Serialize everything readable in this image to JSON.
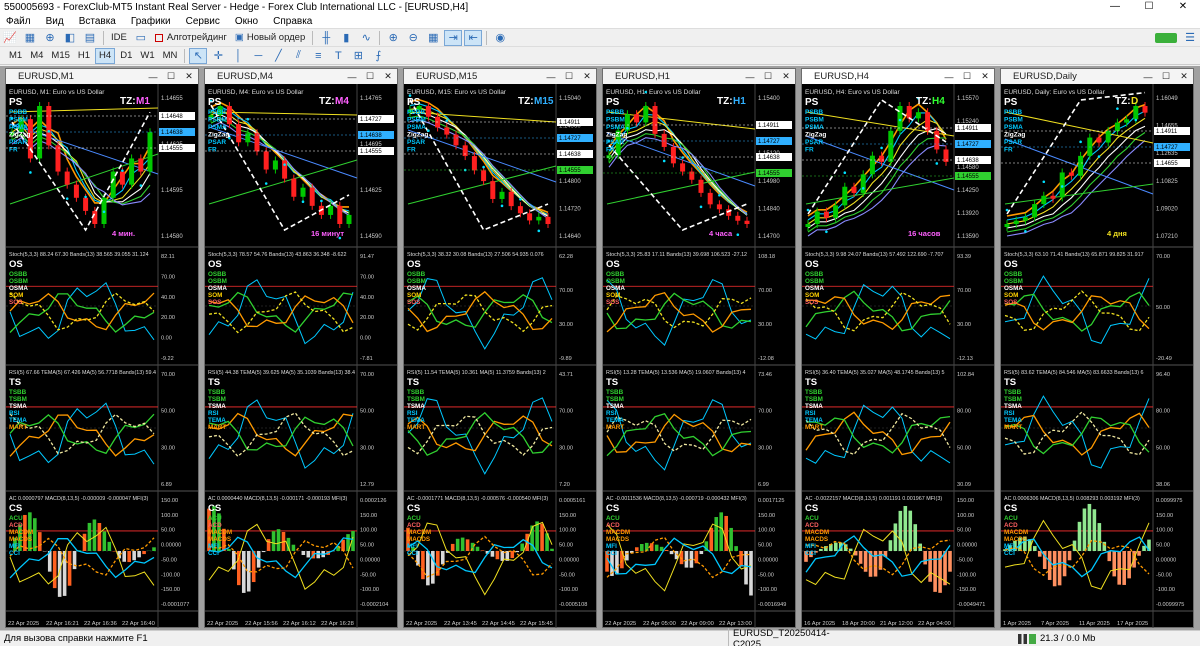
{
  "window": {
    "title": "550005693 - ForexClub-MT5 Instant Real Server - Hedge - Forex Club International LLC - [EURUSD,H4]",
    "minimize": "—",
    "maximize": "☐",
    "close": "✕"
  },
  "menu": [
    "Файл",
    "Вид",
    "Вставка",
    "Графики",
    "Сервис",
    "Окно",
    "Справка"
  ],
  "toolbar": {
    "ide": "IDE",
    "algo": "Алготрейдинг",
    "new_order": "Новый ордер",
    "timeframes": [
      "M1",
      "M4",
      "M15",
      "H1",
      "H4",
      "D1",
      "W1",
      "MN"
    ],
    "active_timeframe": "H4"
  },
  "status": {
    "help": "Для вызова справки нажмите F1",
    "profile": "EURUSD_T20250414-C2025",
    "traffic": "21.3 / 0.0 Mb"
  },
  "colors": {
    "chart_bg": "#000000",
    "bull": "#00c800",
    "bear": "#ff2020",
    "line_orange": "#ff9a00",
    "line_cyan": "#00c8ff",
    "line_yellow": "#f0e020",
    "line_green": "#30d030",
    "line_white": "#ffffff",
    "level_red": "#ff3030"
  },
  "charts": [
    {
      "tab": "EURUSD,M1",
      "pair_caption": "EURUSD, M1:  Euro vs US Dollar",
      "tz": "TZ:",
      "tz_tf": "M1",
      "tz_color": "#ff60ff",
      "timer": "4 мин.",
      "prices": [
        "1.14655",
        "1.14625",
        "1.14595",
        "1.14580"
      ],
      "price_tags": [
        "1.14648",
        "1.14638",
        "1.14555"
      ],
      "osc1_values": "Stoch(5,3,3) 88.24  67.30  Bands(13) 38.565  39.055  31.124",
      "osc1_levels": [
        "82.11",
        "70.00",
        "40.00",
        "20.00",
        "0.00",
        "-9.22"
      ],
      "osc2_values": "RSI(5) 67.66  TEMA(5) 67.426  MA(5) 56.7718  Bands(13) 59.4",
      "osc2_levels": [
        "70.00",
        "50.00",
        "30.00",
        "6.89"
      ],
      "osc3_values": "AC 0.0000797  MACD(8,13,5) -0.000009  -0.000047  MFI(3)",
      "osc3_levels": [
        "150.00",
        "100.00",
        "50.00",
        "0.00000",
        "-50.00",
        "-100.00",
        "-150.00",
        "-0.0001077"
      ],
      "dates": [
        "22 Apr 2025",
        "22 Apr 16:21",
        "22 Apr 16:36",
        "22 Apr 16:40"
      ],
      "closes": [
        1.1464,
        1.1465,
        1.1462,
        1.1466,
        1.1463,
        1.1461,
        1.146,
        1.1459,
        1.1458,
        1.1457,
        1.1459,
        1.1461,
        1.146,
        1.1462,
        1.1461,
        1.1464
      ],
      "active": false
    },
    {
      "tab": "EURUSD,M4",
      "pair_caption": "EURUSD, M4:  Euro vs US Dollar",
      "tz": "TZ:",
      "tz_tf": "M4",
      "tz_color": "#ff60ff",
      "timer": "16 минут",
      "prices": [
        "1.14765",
        "1.14695",
        "1.14625",
        "1.14590"
      ],
      "price_tags": [
        "1.14727",
        "1.14638",
        "1.14555"
      ],
      "osc1_values": "Stoch(5,3,3) 78.57  54.76  Bands(13) 43.863  36.348  -8.622",
      "osc1_levels": [
        "91.47",
        "70.00",
        "40.00",
        "20.00",
        "0.00",
        "-7.81"
      ],
      "osc2_values": "RSI(5) 44.38  TEMA(5) 39.625  MA(5) 35.1039  Bands(13) 38.4",
      "osc2_levels": [
        "70.00",
        "50.00",
        "30.00",
        "12.79"
      ],
      "osc3_values": "AC 0.0000440  MACD(8,13,5) -0.000171  -0.000193  MFI(3)",
      "osc3_levels": [
        "0.0002126",
        "150.00",
        "100.00",
        "50.00",
        "0.00000",
        "-50.00",
        "-100.00",
        "-0.0002104"
      ],
      "dates": [
        "22 Apr 2025",
        "22 Apr 15:56",
        "22 Apr 16:12",
        "22 Apr 16:28"
      ],
      "closes": [
        1.1473,
        1.1474,
        1.1472,
        1.147,
        1.1471,
        1.1469,
        1.1467,
        1.1468,
        1.1466,
        1.1464,
        1.1465,
        1.1463,
        1.1462,
        1.1463,
        1.1461,
        1.1462
      ],
      "active": false
    },
    {
      "tab": "EURUSD,M15",
      "pair_caption": "EURUSD, M15:  Euro vs US Dollar",
      "tz": "TZ:",
      "tz_tf": "M15",
      "tz_color": "#30b0ff",
      "timer": "",
      "prices": [
        "1.15040",
        "1.14960",
        "1.14880",
        "1.14800",
        "1.14720",
        "1.14640"
      ],
      "price_tags": [
        "1.14911",
        "1.14727",
        "1.14638",
        "1.14555"
      ],
      "osc1_values": "Stoch(5,3,3) 38.32  30.08  Bands(13) 27.506  54.935  0.076",
      "osc1_levels": [
        "62.28",
        "70.00",
        "30.00",
        "-9.89"
      ],
      "osc2_values": "RSI(5) 11.54  TEMA(5) 10.361  MA(5) 11.3759  Bands(13) 2",
      "osc2_levels": [
        "43.71",
        "70.00",
        "30.00",
        "7.20"
      ],
      "osc3_values": "AC -0.0001771  MACD(8,13,5) -0.000576  -0.000540  MFI(3)",
      "osc3_levels": [
        "0.0005161",
        "150.00",
        "100.00",
        "50.00",
        "0.00000",
        "-50.00",
        "-100.00",
        "-0.0005108"
      ],
      "dates": [
        "22 Apr 2025",
        "22 Apr 13:45",
        "22 Apr 14:45",
        "22 Apr 15:45"
      ],
      "closes": [
        1.1495,
        1.1496,
        1.1493,
        1.149,
        1.1488,
        1.1485,
        1.1482,
        1.1478,
        1.1475,
        1.147,
        1.1472,
        1.1468,
        1.1466,
        1.1464,
        1.1465,
        1.1463
      ],
      "active": false
    },
    {
      "tab": "EURUSD,H1",
      "pair_caption": "EURUSD, H1:  Euro vs US Dollar",
      "tz": "TZ:",
      "tz_tf": "H1",
      "tz_color": "#30b0ff",
      "timer": "4 часа",
      "prices": [
        "1.15400",
        "1.15260",
        "1.15120",
        "1.14980",
        "1.14840",
        "1.14700"
      ],
      "price_tags": [
        "1.14911",
        "1.14727",
        "1.14638",
        "1.14555"
      ],
      "osc1_values": "Stoch(5,3,3) 25.83  17.11  Bands(13) 39.698  106.523  -27.12",
      "osc1_levels": [
        "108.18",
        "70.00",
        "30.00",
        "-12.08"
      ],
      "osc2_values": "RSI(5) 13.28  TEMA(5) 13.536  MA(5) 19.0607  Bands(13) 4",
      "osc2_levels": [
        "73.46",
        "70.00",
        "30.00",
        "6.99"
      ],
      "osc3_values": "AC -0.0011536  MACD(8,13,5) -0.000719  -0.000432  MFI(3)",
      "osc3_levels": [
        "0.0017125",
        "150.00",
        "100.00",
        "50.00",
        "0.00000",
        "-50.00",
        "-100.00",
        "-0.0016949"
      ],
      "dates": [
        "22 Apr 2025",
        "22 Apr 05:00",
        "22 Apr 09:00",
        "22 Apr 13:00"
      ],
      "closes": [
        1.1505,
        1.152,
        1.153,
        1.1525,
        1.1535,
        1.1518,
        1.151,
        1.15,
        1.1495,
        1.149,
        1.1482,
        1.1475,
        1.1472,
        1.1468,
        1.1465,
        1.1463
      ],
      "active": false
    },
    {
      "tab": "EURUSD,H4",
      "pair_caption": "EURUSD, H4:  Euro vs US Dollar",
      "tz": "TZ:",
      "tz_tf": "H4",
      "tz_color": "#30ff30",
      "timer": "16 часов",
      "prices": [
        "1.15570",
        "1.15240",
        "1.14910",
        "1.14580",
        "1.14250",
        "1.13920",
        "1.13590"
      ],
      "price_tags": [
        "1.14911",
        "1.14727",
        "1.14638",
        "1.14555"
      ],
      "osc1_values": "Stoch(5,3,3) 9.98  24.07  Bands(13) 57.492  122.690  -7.707",
      "osc1_levels": [
        "93.39",
        "70.00",
        "30.00",
        "-12.13"
      ],
      "osc2_values": "RSI(5) 36.40  TEMA(5) 35.027  MA(5) 48.1745  Bands(13) 5",
      "osc2_levels": [
        "102.84",
        "80.00",
        "50.00",
        "30.09"
      ],
      "osc3_values": "AC -0.0022157  MACD(8,13,5) 0.001191  0.001967  MFI(3)",
      "osc3_levels": [
        "150.00",
        "100.00",
        "50.00",
        "0.00000",
        "-50.00",
        "-100.00",
        "-150.00",
        "-0.0049471"
      ],
      "dates": [
        "16 Apr 2025",
        "18 Apr 20:00",
        "21 Apr 12:00",
        "22 Apr 04:00"
      ],
      "closes": [
        1.136,
        1.138,
        1.137,
        1.139,
        1.142,
        1.141,
        1.144,
        1.147,
        1.146,
        1.151,
        1.155,
        1.153,
        1.154,
        1.151,
        1.148,
        1.146
      ],
      "active": true
    },
    {
      "tab": "EURUSD,Daily",
      "pair_caption": "EURUSD, Daily:  Euro vs US Dollar",
      "tz": "TZ:",
      "tz_tf": "D",
      "tz_color": "#f0e020",
      "timer": "4 дня",
      "prices": [
        "1.16049",
        "1.14655",
        "1.12635",
        "1.10825",
        "1.09020",
        "1.07210"
      ],
      "price_tags": [
        "1.14911",
        "1.14727",
        "1.14655"
      ],
      "osc1_values": "Stoch(5,3,3) 63.10  71.41  Bands(13) 65.871  99.825  31.917",
      "osc1_levels": [
        "70.00",
        "50.00",
        "-20.49"
      ],
      "osc2_values": "RSI(5) 83.62  TEMA(5) 84.546  MA(5) 83.6633  Bands(13) 6",
      "osc2_levels": [
        "96.40",
        "80.00",
        "50.00",
        "38.06"
      ],
      "osc3_values": "AC 0.0006306  MACD(8,13,5) 0.008293  0.003192  MFI(3)",
      "osc3_levels": [
        "0.0099975",
        "150.00",
        "100.00",
        "50.00",
        "0.00000",
        "-50.00",
        "-100.00",
        "-0.0099975"
      ],
      "dates": [
        "1 Apr 2025",
        "7 Apr 2025",
        "11 Apr 2025",
        "17 Apr 2025"
      ],
      "closes": [
        1.079,
        1.081,
        1.083,
        1.091,
        1.096,
        1.095,
        1.11,
        1.108,
        1.12,
        1.131,
        1.128,
        1.135,
        1.14,
        1.142,
        1.15,
        1.146
      ],
      "active": false
    }
  ],
  "panel_labels": {
    "ps": "PS",
    "os": "OS",
    "ts": "TS",
    "cs": "CS",
    "ps_items": [
      "PSBB",
      "PSBM",
      "PSMA",
      "ZigZag",
      "PSAR",
      "FR"
    ],
    "os_items": [
      "OSBB",
      "OSBM",
      "OSMA",
      "SOM",
      "SOS"
    ],
    "ts_items": [
      "TSBB",
      "TSBM",
      "TSMA",
      "RSI",
      "TEMA",
      "MART"
    ],
    "cs_items": [
      "ACU",
      "ACD",
      "MACDM",
      "MACDS",
      "MFI",
      "CCI"
    ]
  }
}
